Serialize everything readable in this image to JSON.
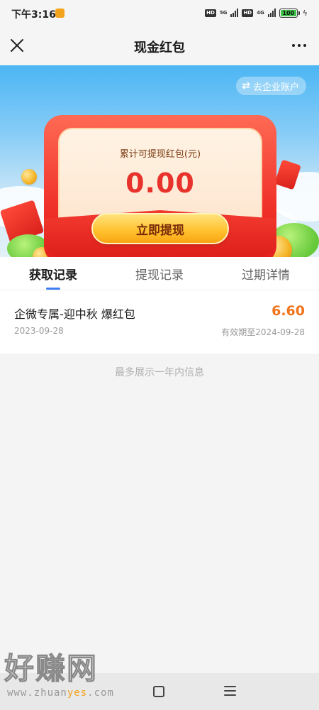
{
  "status_bar": {
    "time": "下午3:16",
    "network_1": "5G",
    "network_2": "4G",
    "hd": "HD",
    "battery": "100"
  },
  "nav": {
    "title": "现金红包"
  },
  "banner": {
    "switch_account": "去企业账户",
    "label": "累计可提现红包(元)",
    "amount": "0.00",
    "withdraw_button": "立即提现"
  },
  "tabs": [
    {
      "label": "获取记录",
      "active": true
    },
    {
      "label": "提现记录",
      "active": false
    },
    {
      "label": "过期详情",
      "active": false
    }
  ],
  "records": [
    {
      "title": "企微专属-迎中秋 爆红包",
      "amount": "6.60",
      "date": "2023-09-28",
      "expiry": "有效期至2024-09-28"
    }
  ],
  "footnote": "最多展示一年内信息",
  "watermark": {
    "logo": "好赚网",
    "url_prefix": "www.zhuan",
    "url_accent": "yes",
    "url_suffix": ".com"
  },
  "colors": {
    "accent_blue": "#3f7ef0",
    "amount_orange": "#f0741c",
    "amount_red": "#e8322c"
  }
}
